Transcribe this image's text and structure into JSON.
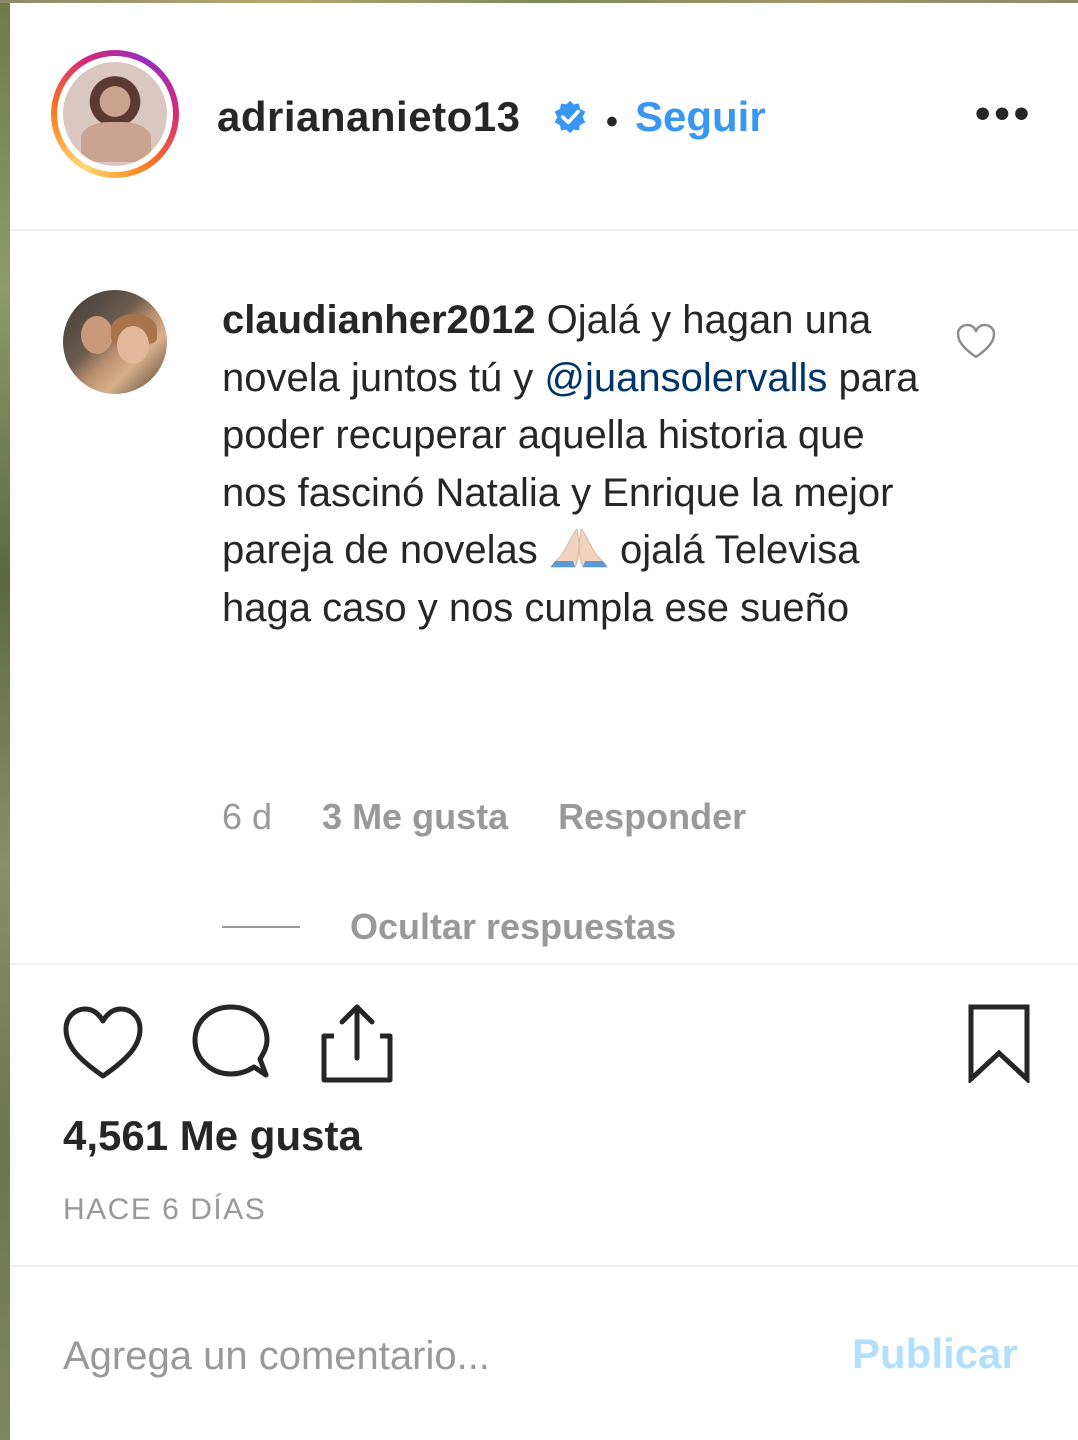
{
  "header": {
    "username": "adriananieto13",
    "separator": "•",
    "follow_label": "Seguir",
    "more_label": "•••"
  },
  "comment": {
    "author": "claudianher2012",
    "text_before_mention": " Ojalá y hagan una novela juntos tú y ",
    "mention": "@juansolervalls",
    "text_after_mention": " para poder recuperar aquella historia que nos fascinó Natalia y Enrique la mejor pareja de novelas ",
    "text_after_emoji": " ojalá Televisa haga caso y nos cumpla ese sueño",
    "age": "6 d",
    "likes": "3 Me gusta",
    "reply_label": "Responder",
    "hide_replies_label": "Ocultar respuestas"
  },
  "post": {
    "likes": "4,561 Me gusta",
    "time": "HACE 6 DÍAS"
  },
  "add_comment": {
    "placeholder": "Agrega un comentario...",
    "publish_label": "Publicar"
  },
  "colors": {
    "text": "#262626",
    "accent": "#3897f0",
    "mention": "#003569",
    "muted": "#999999",
    "publish_disabled": "#b2dffc",
    "divider": "#efefef"
  },
  "icons": {
    "verified": "verified-badge-icon",
    "comment_like": "heart-outline-icon",
    "like": "heart-outline-icon",
    "comment": "speech-bubble-icon",
    "share": "share-upload-icon",
    "save": "bookmark-icon",
    "emoji": "folded-hands-emoji"
  }
}
